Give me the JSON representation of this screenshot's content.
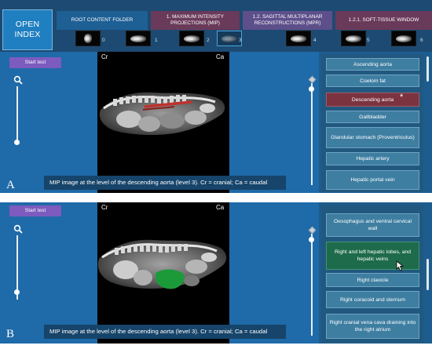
{
  "header": {
    "open_index": [
      "OPEN",
      "INDEX"
    ],
    "tabs": [
      {
        "label": "ROOT CONTENT FOLDER"
      },
      {
        "label": "1. MAXIMUM INTENSITY PROJECTIONS (MIP)"
      },
      {
        "label": "1.2. SAGITTAL MULTIPLANAR RECONSTRUCTIONS (MPR)"
      },
      {
        "label": "1.2.1. SOFT-TISSUE WINDOW"
      }
    ],
    "thumbnails": [
      "0",
      "1",
      "2",
      "3",
      "4",
      "5",
      "6"
    ],
    "active_thumbnail": "3"
  },
  "panel_a": {
    "start_test": "Start test",
    "corner_label": "A",
    "orientation": {
      "cranial": "Cr",
      "caudal": "Ca"
    },
    "caption": "MIP image at the level of the descending aorta (level 3). Cr = cranial; Ca = caudal",
    "structures": [
      {
        "label": "Ascending aorta",
        "state": "default"
      },
      {
        "label": "Coelom fat",
        "state": "default"
      },
      {
        "label": "Descending aorta",
        "state": "selected"
      },
      {
        "label": "Gallbladder",
        "state": "default"
      },
      {
        "label": "Glandular stomach (Proventriculus)",
        "state": "default"
      },
      {
        "label": "Hepatic artery",
        "state": "default"
      },
      {
        "label": "Hepatic portal vein",
        "state": "default"
      }
    ],
    "highlight_color": "#c0322c"
  },
  "panel_b": {
    "start_test": "Start test",
    "corner_label": "B",
    "orientation": {
      "cranial": "Cr",
      "caudal": "Ca"
    },
    "caption": "MIP image at the level of the descending aorta (level 3). Cr = cranial; Ca = caudal",
    "structures": [
      {
        "label": "Oesophagus and ventral cervical wall",
        "state": "default"
      },
      {
        "label": "Right and left hepatic lobes, and hepatic veins",
        "state": "hover"
      },
      {
        "label": "Right clavicle",
        "state": "default"
      },
      {
        "label": "Right coracoid and sternum",
        "state": "default"
      },
      {
        "label": "Right cranial vena cava draining into the right atrium",
        "state": "default"
      }
    ],
    "highlight_color": "#1c9a3a"
  },
  "icons": {
    "zoom": "magnifier-icon",
    "selected_marker": "asterisk-icon",
    "pointer": "hand-pointer-icon",
    "slider_cap": "diamond-icon"
  },
  "colors": {
    "header_bg": "#1d4a72",
    "panel_bg": "#2e5e84",
    "start_button": "#7d5bbf",
    "selected_item": "#7b3340",
    "hover_item": "#1e6b4c"
  }
}
